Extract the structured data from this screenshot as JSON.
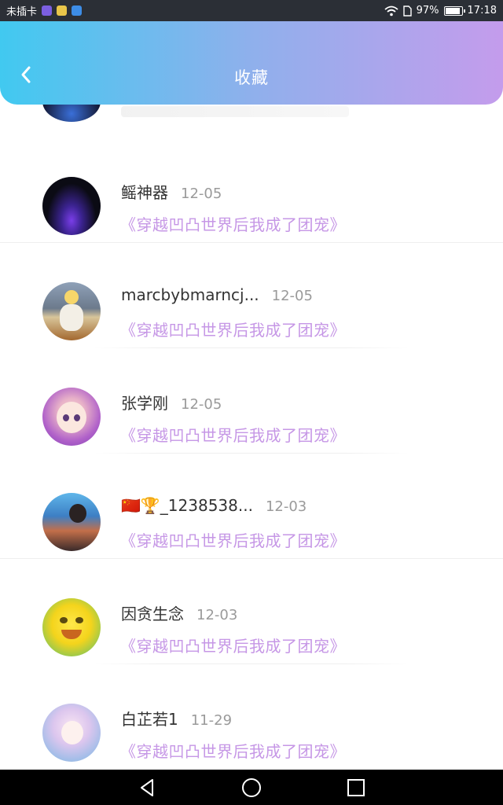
{
  "status_bar": {
    "carrier": "未插卡",
    "battery_percent": "97%",
    "battery_level": 0.97,
    "time": "17:18",
    "icons": [
      "gallery-app-icon",
      "wechat-app-icon",
      "app-icon",
      "wifi-icon",
      "sim-icon",
      "battery-icon"
    ]
  },
  "header": {
    "title": "收藏",
    "back_icon": "chevron-left-icon",
    "gradient": [
      "#41c9f0",
      "#8fb0ec",
      "#c49cec"
    ]
  },
  "favorites": [
    {
      "name": "鳐神器",
      "date": "12-05",
      "book": "《穿越凹凸世界后我成了团宠》"
    },
    {
      "name": "marcbybmarncj...",
      "date": "12-05",
      "book": "《穿越凹凸世界后我成了团宠》"
    },
    {
      "name": "张学刚",
      "date": "12-05",
      "book": "《穿越凹凸世界后我成了团宠》"
    },
    {
      "name": "🇨🇳🏆_1238538...",
      "date": "12-03",
      "book": "《穿越凹凸世界后我成了团宠》"
    },
    {
      "name": "因贪生念",
      "date": "12-03",
      "book": "《穿越凹凸世界后我成了团宠》"
    },
    {
      "name": "白芷若1",
      "date": "11-29",
      "book": "《穿越凹凸世界后我成了团宠》"
    }
  ],
  "colors": {
    "book_title": "#c697e6",
    "name": "#333333",
    "date": "#9a9a9a"
  },
  "nav": {
    "back": "triangle-back-icon",
    "home": "circle-home-icon",
    "recents": "square-recents-icon"
  }
}
